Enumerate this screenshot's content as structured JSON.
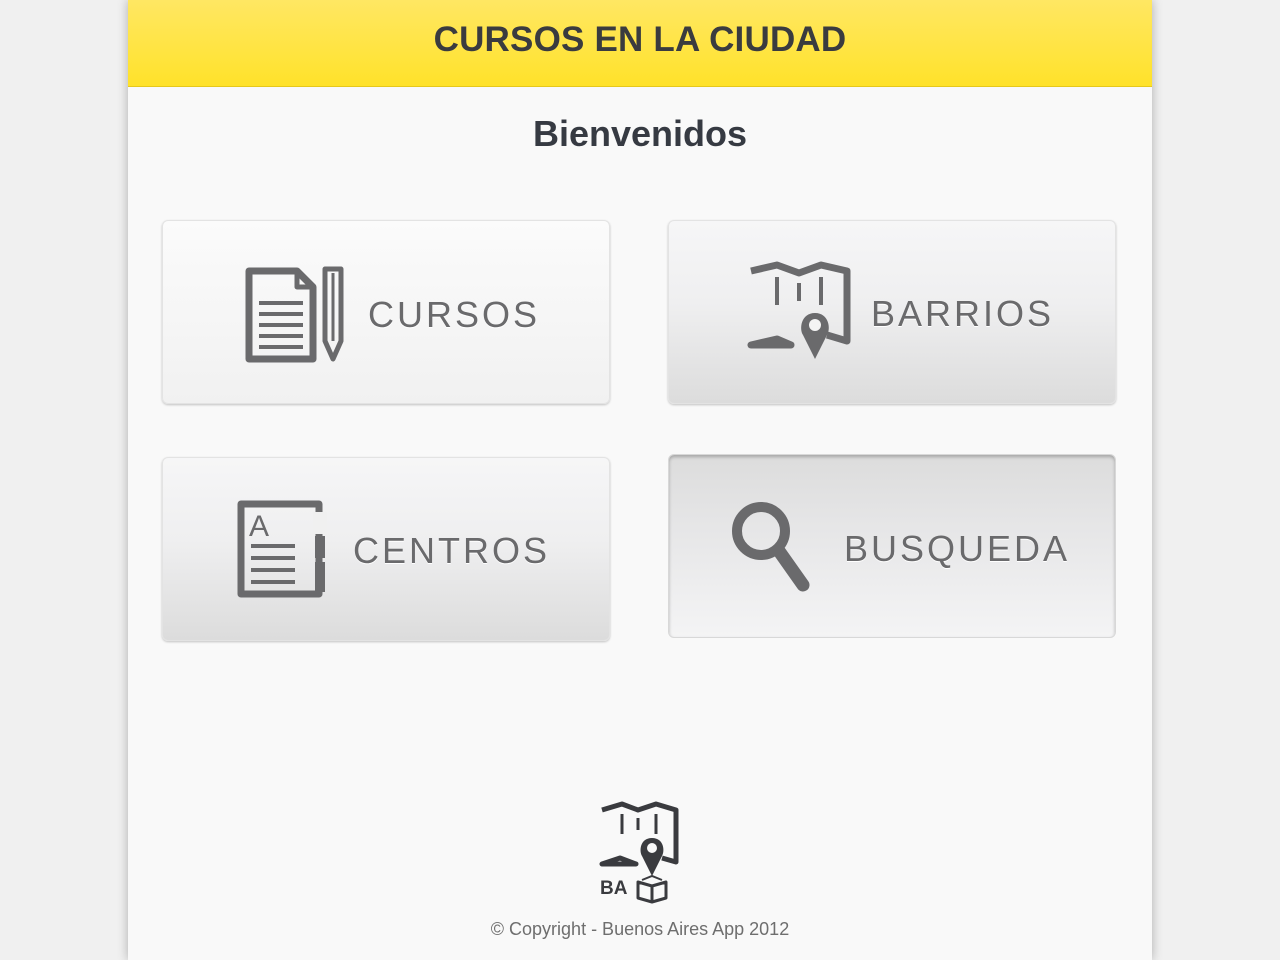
{
  "header": {
    "title": "CURSOS EN LA CIUDAD"
  },
  "welcome": "Bienvenidos",
  "menu": {
    "cursos": {
      "label": "CURSOS",
      "icon": "document-pencil-icon"
    },
    "barrios": {
      "label": "BARRIOS",
      "icon": "map-pin-icon"
    },
    "centros": {
      "label": "CENTROS",
      "icon": "address-book-icon"
    },
    "busqueda": {
      "label": "BUSQUEDA",
      "icon": "search-icon"
    }
  },
  "logo": {
    "icon": "ba-map-book-logo",
    "text": "BA"
  },
  "footer": {
    "copyright": "© Copyright - Buenos Aires App 2012"
  },
  "colors": {
    "header_yellow": "#ffe22a",
    "title_text": "#3a3b3f",
    "icon_gray": "#6a6a6c",
    "background": "#f9f9f9"
  }
}
